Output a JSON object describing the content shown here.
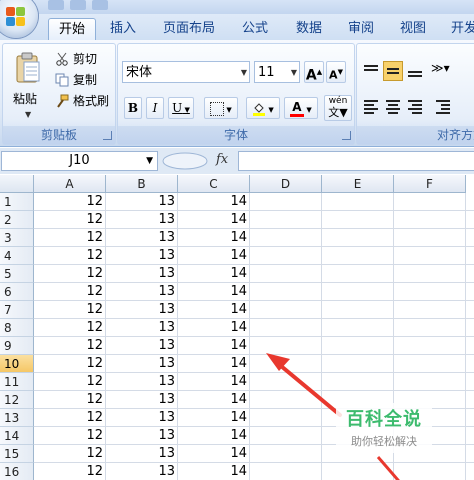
{
  "ribbon": {
    "tabs": [
      "开始",
      "插入",
      "页面布局",
      "公式",
      "数据",
      "审阅",
      "视图",
      "开发"
    ],
    "active_tab": "开始",
    "clipboard": {
      "paste_label": "粘贴",
      "cut_label": "剪切",
      "copy_label": "复制",
      "format_painter_label": "格式刷",
      "group_label": "剪贴板"
    },
    "font": {
      "font_name": "宋体",
      "font_size": "11",
      "bold": "B",
      "italic": "I",
      "underline": "U",
      "font_color_letter": "A",
      "phonetic_label": "wén\n文",
      "group_label": "字体",
      "grow_font": "A",
      "shrink_font": "A"
    },
    "alignment": {
      "group_label": "对齐方式"
    },
    "colors": {
      "highlight": "#ffff00",
      "font_color": "#ff0000",
      "active_align": "#f8d16b"
    }
  },
  "formula_bar": {
    "name_box": "J10",
    "fx": "fx",
    "value": ""
  },
  "sheet": {
    "columns": [
      "A",
      "B",
      "C",
      "D",
      "E",
      "F"
    ],
    "rows": [
      "1",
      "2",
      "3",
      "4",
      "5",
      "6",
      "7",
      "8",
      "9",
      "10",
      "11",
      "12",
      "13",
      "14",
      "15",
      "16"
    ],
    "selected_row": "10",
    "data": [
      [
        "12",
        "13",
        "14"
      ],
      [
        "12",
        "13",
        "14"
      ],
      [
        "12",
        "13",
        "14"
      ],
      [
        "12",
        "13",
        "14"
      ],
      [
        "12",
        "13",
        "14"
      ],
      [
        "12",
        "13",
        "14"
      ],
      [
        "12",
        "13",
        "14"
      ],
      [
        "12",
        "13",
        "14"
      ],
      [
        "12",
        "13",
        "14"
      ],
      [
        "12",
        "13",
        "14"
      ],
      [
        "12",
        "13",
        "14"
      ],
      [
        "12",
        "13",
        "14"
      ],
      [
        "12",
        "13",
        "14"
      ],
      [
        "12",
        "13",
        "14"
      ],
      [
        "12",
        "13",
        "14"
      ],
      [
        "12",
        "13",
        "14"
      ]
    ]
  },
  "watermark": {
    "title": "百科全说",
    "subtitle": "助你轻松解决"
  }
}
